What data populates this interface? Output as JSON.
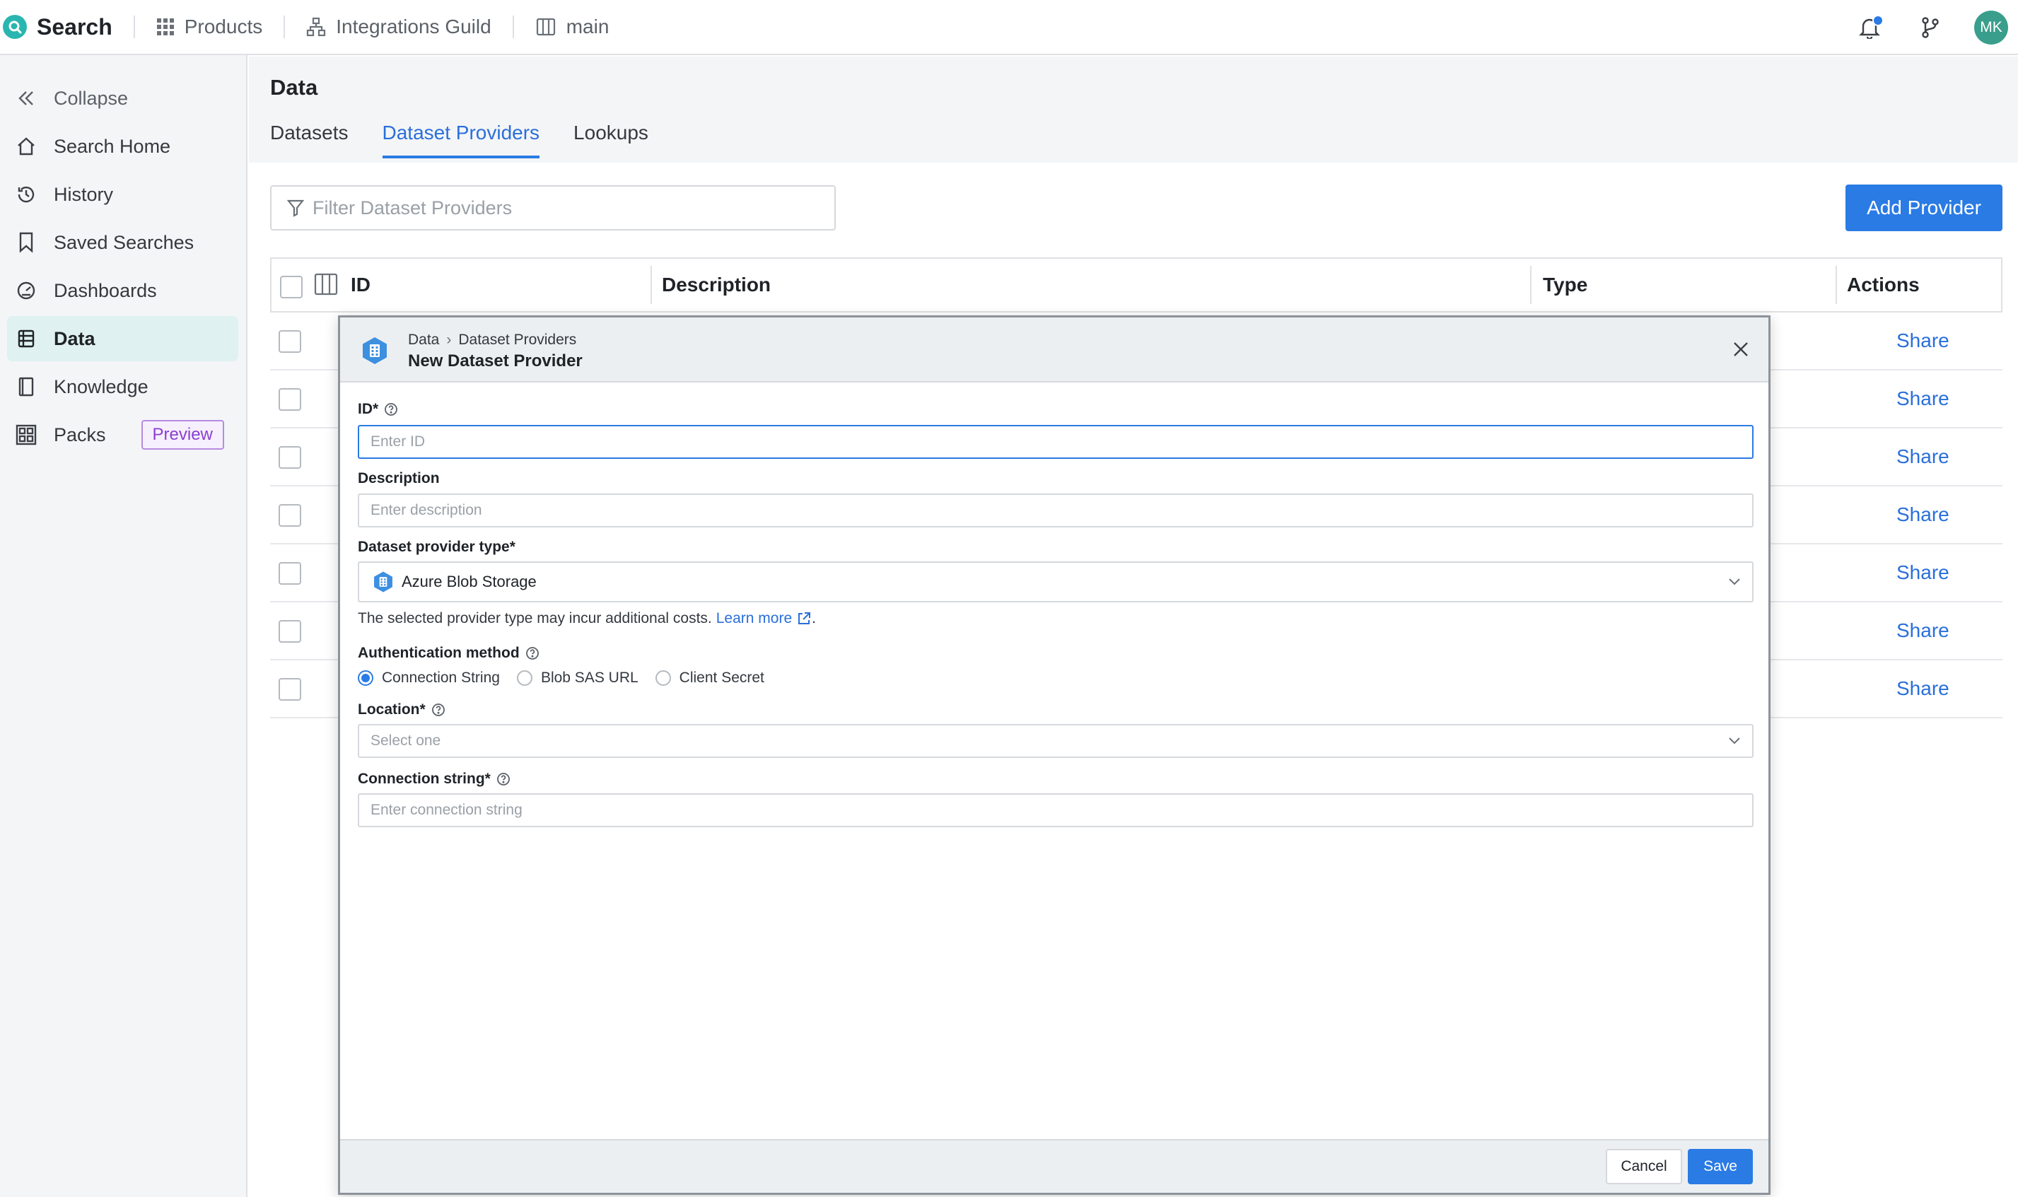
{
  "app": {
    "name": "Search"
  },
  "topnav": [
    {
      "label": "Products",
      "icon": "grid-icon"
    },
    {
      "label": "Integrations Guild",
      "icon": "org-icon"
    },
    {
      "label": "main",
      "icon": "branch-book-icon"
    }
  ],
  "user": {
    "initials": "MK"
  },
  "sidebar": {
    "collapse_label": "Collapse",
    "items": [
      {
        "label": "Search Home",
        "icon": "home-icon"
      },
      {
        "label": "History",
        "icon": "history-icon"
      },
      {
        "label": "Saved Searches",
        "icon": "bookmark-icon"
      },
      {
        "label": "Dashboards",
        "icon": "gauge-icon"
      },
      {
        "label": "Data",
        "icon": "data-icon",
        "active": true
      },
      {
        "label": "Knowledge",
        "icon": "book-icon"
      },
      {
        "label": "Packs",
        "icon": "packs-icon",
        "badge": "Preview"
      }
    ]
  },
  "page": {
    "title": "Data",
    "tabs": [
      {
        "label": "Datasets",
        "active": false
      },
      {
        "label": "Dataset Providers",
        "active": true
      },
      {
        "label": "Lookups",
        "active": false
      }
    ],
    "filter_placeholder": "Filter Dataset Providers",
    "add_button": "Add Provider"
  },
  "table": {
    "columns": [
      "ID",
      "Description",
      "Type",
      "Actions"
    ],
    "rows": [
      {
        "action": "Share"
      },
      {
        "action": "Share"
      },
      {
        "action": "Share"
      },
      {
        "action": "Share"
      },
      {
        "action": "Share"
      },
      {
        "action": "Share"
      },
      {
        "action": "Share"
      }
    ]
  },
  "modal": {
    "breadcrumb": [
      "Data",
      "Dataset Providers"
    ],
    "breadcrumb_separator": "›",
    "title": "New Dataset Provider",
    "id_label": "ID*",
    "id_placeholder": "Enter ID",
    "description_label": "Description",
    "description_placeholder": "Enter description",
    "type_label": "Dataset provider type*",
    "type_value": "Azure Blob Storage",
    "type_hint": "The selected provider type may incur additional costs.",
    "learn_more": "Learn more",
    "hint_end": ".",
    "auth_label": "Authentication method",
    "auth_options": [
      {
        "label": "Connection String",
        "selected": true
      },
      {
        "label": "Blob SAS URL",
        "selected": false
      },
      {
        "label": "Client Secret",
        "selected": false
      }
    ],
    "location_label": "Location*",
    "location_placeholder": "Select one",
    "conn_label": "Connection string*",
    "conn_placeholder": "Enter connection string",
    "cancel": "Cancel",
    "save": "Save"
  },
  "colors": {
    "accent": "#2a7be4",
    "brand": "#29b6b0",
    "active_nav_bg": "#dff1f0",
    "badge": "#8a3fd1"
  }
}
